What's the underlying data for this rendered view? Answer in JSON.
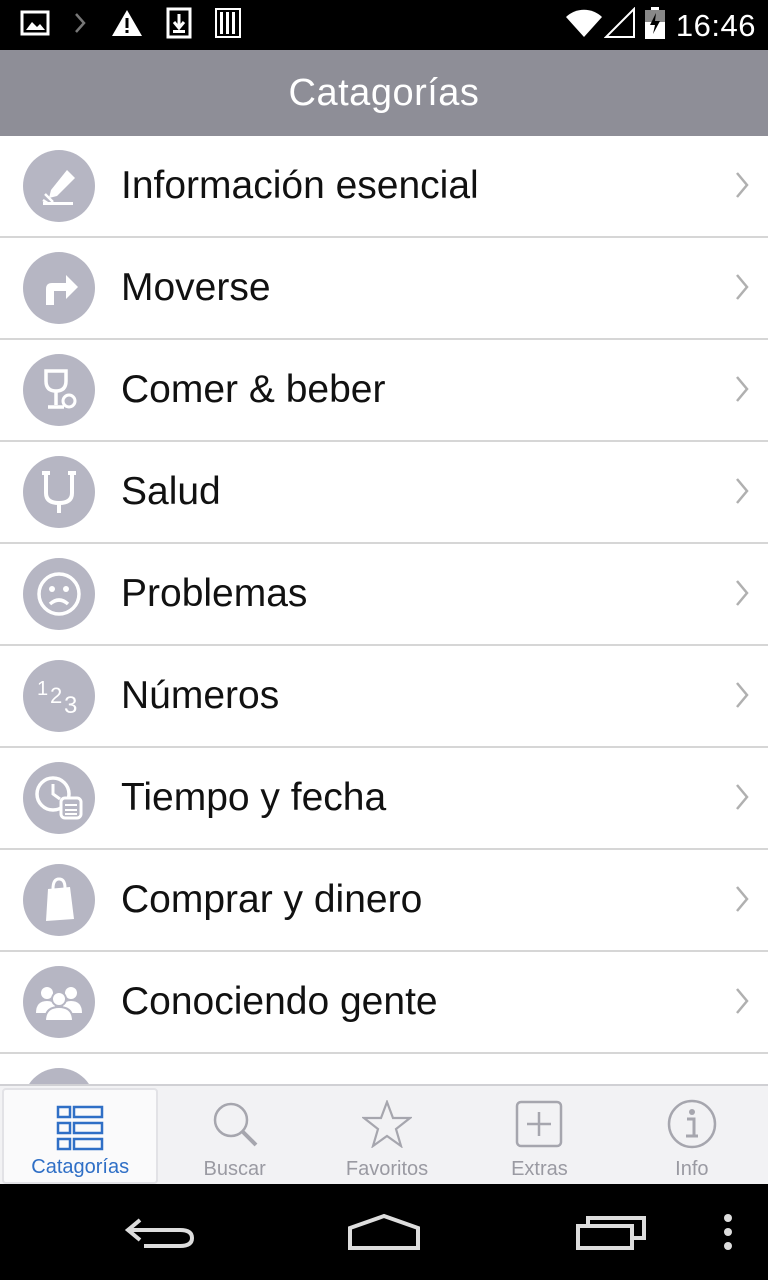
{
  "status_bar": {
    "time": "16:46",
    "left_icons": [
      "image-icon",
      "chevron-right-icon",
      "warning-icon",
      "download-icon",
      "barcode-icon"
    ],
    "right_icons": [
      "wifi-icon",
      "signal-icon",
      "battery-icon"
    ]
  },
  "header": {
    "title": "Catagorías"
  },
  "categories": [
    {
      "label": "Información esencial",
      "icon": "pencil-icon"
    },
    {
      "label": "Moverse",
      "icon": "turn-right-arrow-icon"
    },
    {
      "label": "Comer & beber",
      "icon": "wine-glass-icon"
    },
    {
      "label": "Salud",
      "icon": "stethoscope-icon"
    },
    {
      "label": "Problemas",
      "icon": "sad-face-icon"
    },
    {
      "label": "Números",
      "icon": "numbers-icon"
    },
    {
      "label": "Tiempo y fecha",
      "icon": "clock-calendar-icon"
    },
    {
      "label": "Comprar y dinero",
      "icon": "shopping-bag-icon"
    },
    {
      "label": "Conociendo gente",
      "icon": "people-icon"
    }
  ],
  "tabs": [
    {
      "label": "Catagorías",
      "icon": "list-grid-icon",
      "active": true
    },
    {
      "label": "Buscar",
      "icon": "search-icon",
      "active": false
    },
    {
      "label": "Favoritos",
      "icon": "star-icon",
      "active": false
    },
    {
      "label": "Extras",
      "icon": "plus-box-icon",
      "active": false
    },
    {
      "label": "Info",
      "icon": "info-icon",
      "active": false
    }
  ],
  "colors": {
    "header_bg": "#8e8e97",
    "icon_circle": "#b6b6c3",
    "active_tab": "#2f6fc6",
    "inactive_tab": "#9a9aa2"
  }
}
